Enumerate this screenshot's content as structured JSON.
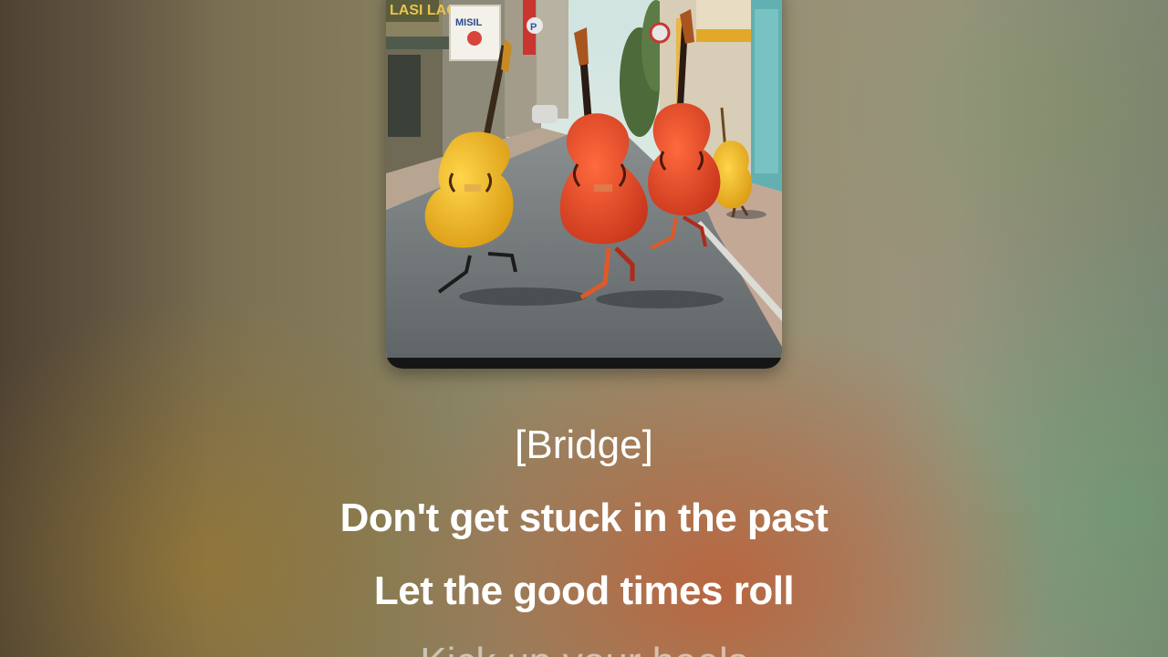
{
  "player": {
    "artwork": {
      "signs": {
        "shop_sign": "LASI LAO",
        "poster_sign": "MISIL",
        "round_sign": "P"
      }
    },
    "lyrics": {
      "section_label": "[Bridge]",
      "lines": [
        "Don't get stuck in the past",
        "Let the good times roll"
      ],
      "upcoming_line": "Kick up your heels"
    }
  },
  "colors": {
    "lyric_text": "#ffffff",
    "cello_yellow": "#e8b21e",
    "cello_red": "#e1492a",
    "street_gray": "#6f7477"
  }
}
